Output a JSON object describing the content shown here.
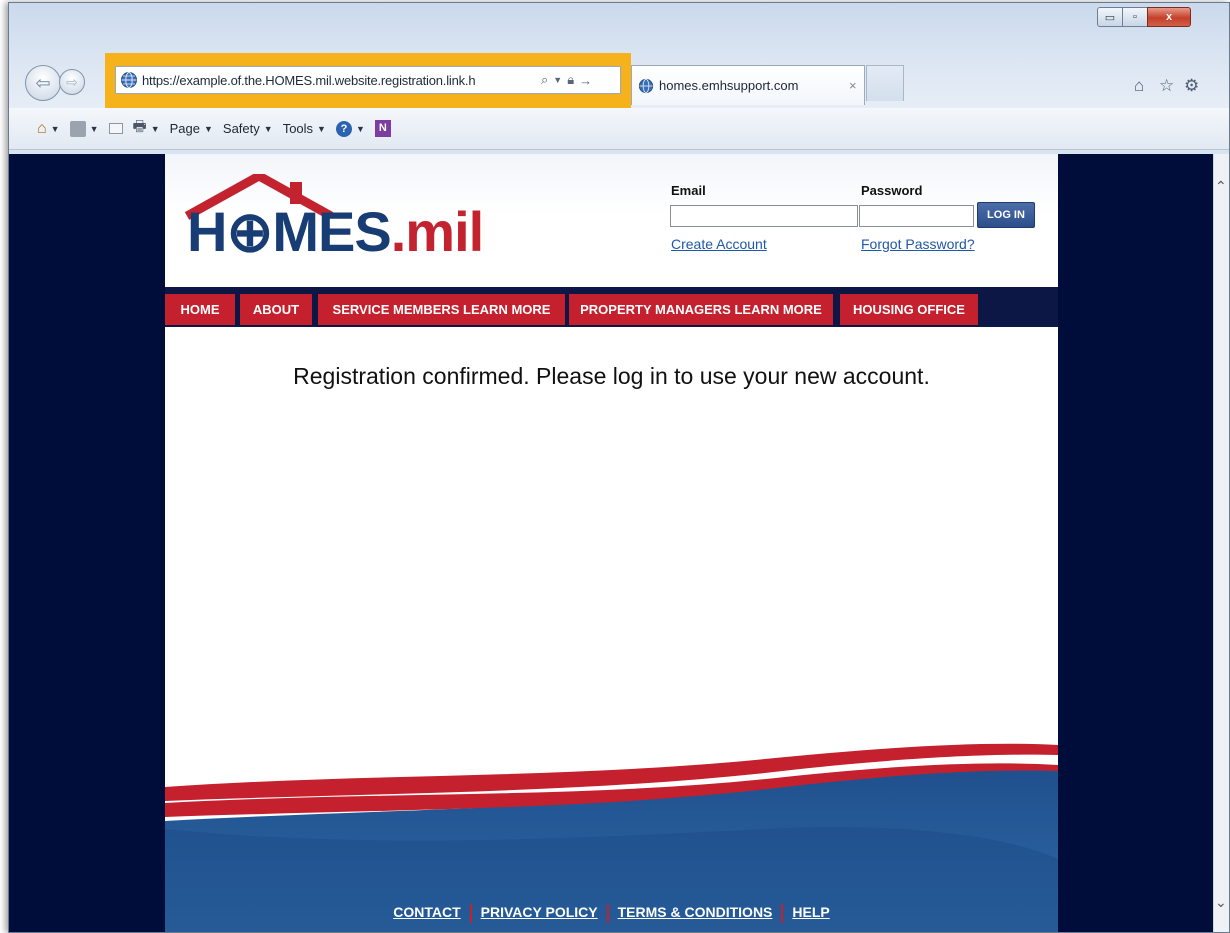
{
  "browser": {
    "address_url": "https://example.of.the.HOMES.mil.website.registration.link.h",
    "tab_title": "homes.emhsupport.com",
    "tab_close": "×",
    "window_controls": {
      "minimize": "▭",
      "maximize": "▫",
      "close": "x"
    },
    "icons": {
      "home": "home-icon",
      "favorites": "star-icon",
      "tools": "gear-icon"
    },
    "highlight_color": "#f5b21b"
  },
  "command_bar": {
    "page_label": "Page",
    "safety_label": "Safety",
    "tools_label": "Tools"
  },
  "site": {
    "logo": {
      "main": "H⊕MES",
      "suffix": ".mil"
    },
    "login": {
      "email_label": "Email",
      "password_label": "Password",
      "email_value": "",
      "password_value": "",
      "login_button": "LOG IN",
      "create_account": "Create Account",
      "forgot_password": "Forgot Password?"
    },
    "nav": [
      {
        "label": "HOME"
      },
      {
        "label": "ABOUT"
      },
      {
        "label": "SERVICE MEMBERS LEARN MORE"
      },
      {
        "label": "PROPERTY MANAGERS LEARN MORE"
      },
      {
        "label": "HOUSING OFFICE"
      }
    ],
    "message": "Registration confirmed. Please log in to use your new account.",
    "footer": [
      {
        "label": "CONTACT"
      },
      {
        "label": "PRIVACY POLICY"
      },
      {
        "label": "TERMS & CONDITIONS"
      },
      {
        "label": "HELP"
      }
    ],
    "colors": {
      "navy": "#0c1745",
      "red": "#c5202e",
      "blue": "#183c74"
    }
  }
}
